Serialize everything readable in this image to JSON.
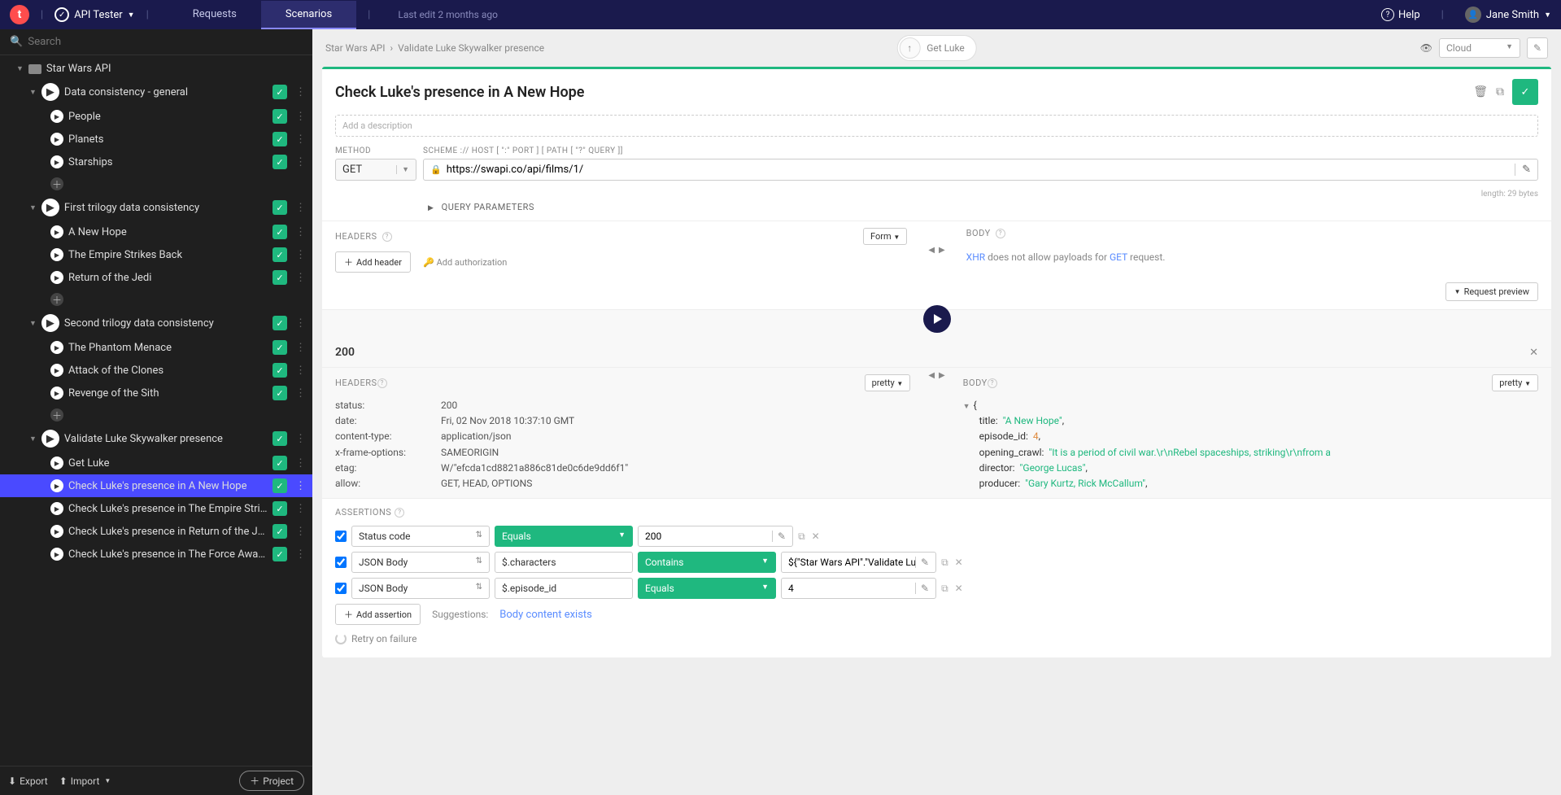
{
  "topbar": {
    "app_name": "API Tester",
    "tabs": {
      "requests": "Requests",
      "scenarios": "Scenarios"
    },
    "last_edit": "Last edit 2 months ago",
    "help": "Help",
    "user": "Jane Smith"
  },
  "sidebar": {
    "search_placeholder": "Search",
    "project_name": "Star Wars API",
    "groups": [
      {
        "label": "Data consistency - general",
        "items": [
          "People",
          "Planets",
          "Starships"
        ]
      },
      {
        "label": "First trilogy data consistency",
        "items": [
          "A New Hope",
          "The Empire Strikes Back",
          "Return of the Jedi"
        ]
      },
      {
        "label": "Second trilogy data consistency",
        "items": [
          "The Phantom Menace",
          "Attack of the Clones",
          "Revenge of the Sith"
        ]
      },
      {
        "label": "Validate Luke Skywalker presence",
        "items": [
          "Get Luke",
          "Check Luke's presence in A New Hope",
          "Check Luke's presence in The Empire Strikes ...",
          "Check Luke's presence in Return of the Jedi",
          "Check Luke's presence in The Force Awakens"
        ]
      }
    ],
    "footer": {
      "export": "Export",
      "import": "Import",
      "project": "Project"
    }
  },
  "breadcrumb": {
    "project": "Star Wars API",
    "scenario": "Validate Luke Skywalker presence"
  },
  "center_pill": "Get Luke",
  "visibility": {
    "value": "Cloud"
  },
  "panel": {
    "title": "Check Luke's presence in A New Hope",
    "description_placeholder": "Add a description",
    "method_label": "METHOD",
    "url_label": "SCHEME :// HOST [ \":\" PORT ] [ PATH [ \"?\" QUERY ]]",
    "method": "GET",
    "url": "https://swapi.co/api/films/1/",
    "url_length": "length: 29 bytes",
    "query_params": "QUERY PARAMETERS",
    "headers_label": "HEADERS",
    "body_label": "BODY",
    "form_mode": "Form",
    "add_header": "Add header",
    "add_auth": "Add authorization",
    "xhr_msg1": "XHR",
    "xhr_msg2": " does not allow payloads for ",
    "xhr_msg3": "GET",
    "xhr_msg4": " request.",
    "request_preview": "Request preview"
  },
  "response": {
    "status": "200",
    "headers_label": "HEADERS",
    "body_label": "BODY",
    "pretty": "pretty",
    "headers": [
      {
        "k": "status:",
        "v": "200"
      },
      {
        "k": "date:",
        "v": "Fri, 02 Nov 2018 10:37:10 GMT"
      },
      {
        "k": "content-type:",
        "v": "application/json"
      },
      {
        "k": "x-frame-options:",
        "v": "SAMEORIGIN"
      },
      {
        "k": "etag:",
        "v": "W/\"efcda1cd8821a886c81de0c6de9dd6f1\""
      },
      {
        "k": "allow:",
        "v": "GET, HEAD, OPTIONS"
      }
    ],
    "json": {
      "title": "\"A New Hope\"",
      "episode_id": "4",
      "opening_crawl": "\"It is a period of civil war.\\r\\nRebel spaceships, striking\\r\\nfrom a",
      "director": "\"George Lucas\"",
      "producer": "\"Gary Kurtz, Rick McCallum\""
    }
  },
  "assertions": {
    "label": "ASSERTIONS",
    "rows": [
      {
        "source": "Status code",
        "path": "",
        "op": "Equals",
        "val": "200",
        "has_path": false
      },
      {
        "source": "JSON Body",
        "path": "$.characters",
        "op": "Contains",
        "val": "${\"Star Wars API\".\"Validate Lu",
        "has_path": true
      },
      {
        "source": "JSON Body",
        "path": "$.episode_id",
        "op": "Equals",
        "val": "4",
        "has_path": true
      }
    ],
    "add": "Add assertion",
    "suggestions_label": "Suggestions:",
    "suggestion": "Body content exists",
    "retry": "Retry on failure"
  }
}
